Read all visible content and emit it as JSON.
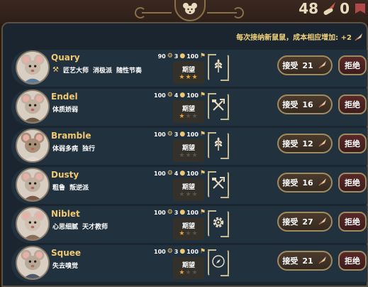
{
  "header": {
    "mouse_badge_icon": "mouse-head-icon",
    "resource_count": "48",
    "resource_icon": "quill-scroll-icon",
    "resource_count_2": "0",
    "resource_icon_2": "ribbon-icon"
  },
  "hint": {
    "text": "每次接纳新鼠鼠，成本相应增加: +2",
    "icon": "quill-icon"
  },
  "labels": {
    "expectation": "期望",
    "accept": "接受",
    "reject": "拒绝"
  },
  "recruits": [
    {
      "name": "Quary",
      "traits": [
        "匠艺大师",
        "消极派",
        "随性节奏"
      ],
      "has_trait_icon": true,
      "stat_a": "90",
      "stat_b": "3",
      "stat_c": "100",
      "expectation_stars": 3,
      "role_icon": "wheat-icon",
      "cost": "21"
    },
    {
      "name": "Endel",
      "traits": [
        "体质娇弱"
      ],
      "has_trait_icon": false,
      "stat_a": "100",
      "stat_b": "4",
      "stat_c": "100",
      "expectation_stars": 1,
      "role_icon": "crossed-tools-icon",
      "cost": "16"
    },
    {
      "name": "Bramble",
      "traits": [
        "体弱多病",
        "独行"
      ],
      "has_trait_icon": false,
      "stat_a": "100",
      "stat_b": "3",
      "stat_c": "100",
      "expectation_stars": 0,
      "role_icon": "wheat-icon",
      "cost": "12"
    },
    {
      "name": "Dusty",
      "traits": [
        "粗鲁",
        "叛逆派"
      ],
      "has_trait_icon": false,
      "stat_a": "100",
      "stat_b": "4",
      "stat_c": "100",
      "expectation_stars": 0,
      "role_icon": "crossed-tools-icon",
      "cost": "16"
    },
    {
      "name": "Niblet",
      "traits": [
        "心思细腻",
        "天才教师"
      ],
      "has_trait_icon": false,
      "stat_a": "100",
      "stat_b": "3",
      "stat_c": "100",
      "expectation_stars": 1,
      "role_icon": "gear-icon",
      "cost": "27"
    },
    {
      "name": "Squee",
      "traits": [
        "失去嗅觉"
      ],
      "has_trait_icon": false,
      "stat_a": "100",
      "stat_b": "3",
      "stat_c": "100",
      "expectation_stars": 1,
      "role_icon": "compass-icon",
      "cost": "21"
    }
  ]
}
